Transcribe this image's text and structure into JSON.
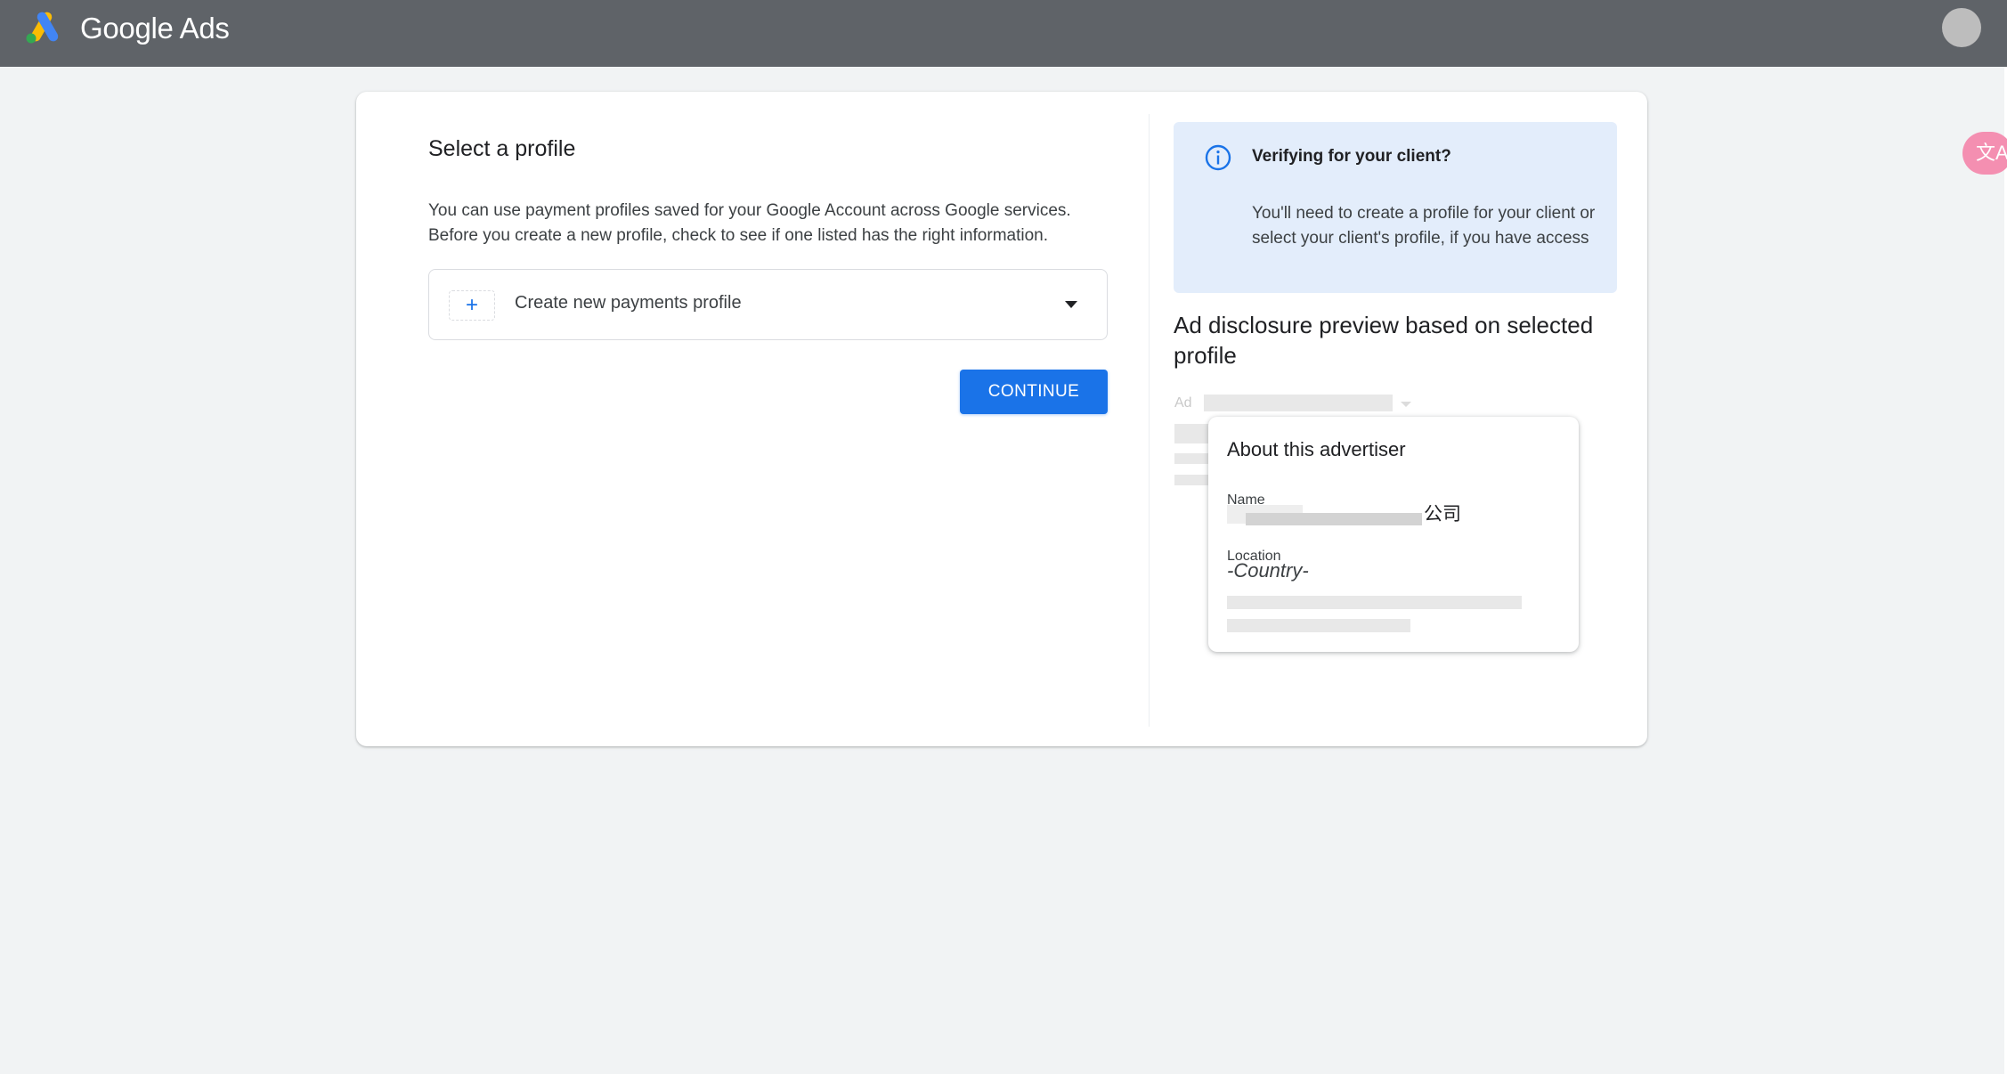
{
  "header": {
    "brand": "Google Ads",
    "translate_icon_glyph": "文A"
  },
  "left": {
    "title": "Select a profile",
    "description_line1": "You can use payment profiles saved for your Google Account across Google services.",
    "description_line2": "Before you create a new profile, check to see if one listed has the right information.",
    "profile_select": {
      "plus": "+",
      "selected_value": "Create new payments profile"
    },
    "continue_label": "CONTINUE"
  },
  "right": {
    "info": {
      "title": "Verifying for your client?",
      "body": "You'll need to create a profile for your client or select your client's profile, if you have access"
    },
    "preview_title": "Ad disclosure preview based on selected profile",
    "ad_tag": "Ad",
    "advertiser": {
      "title": "About this advertiser",
      "name_label": "Name",
      "name_value_suffix": "公司",
      "location_label": "Location",
      "location_value": "-Country-"
    }
  },
  "colors": {
    "accent": "#1a73e8",
    "topbar": "#5f6368",
    "info_bg": "#e3edfb"
  }
}
